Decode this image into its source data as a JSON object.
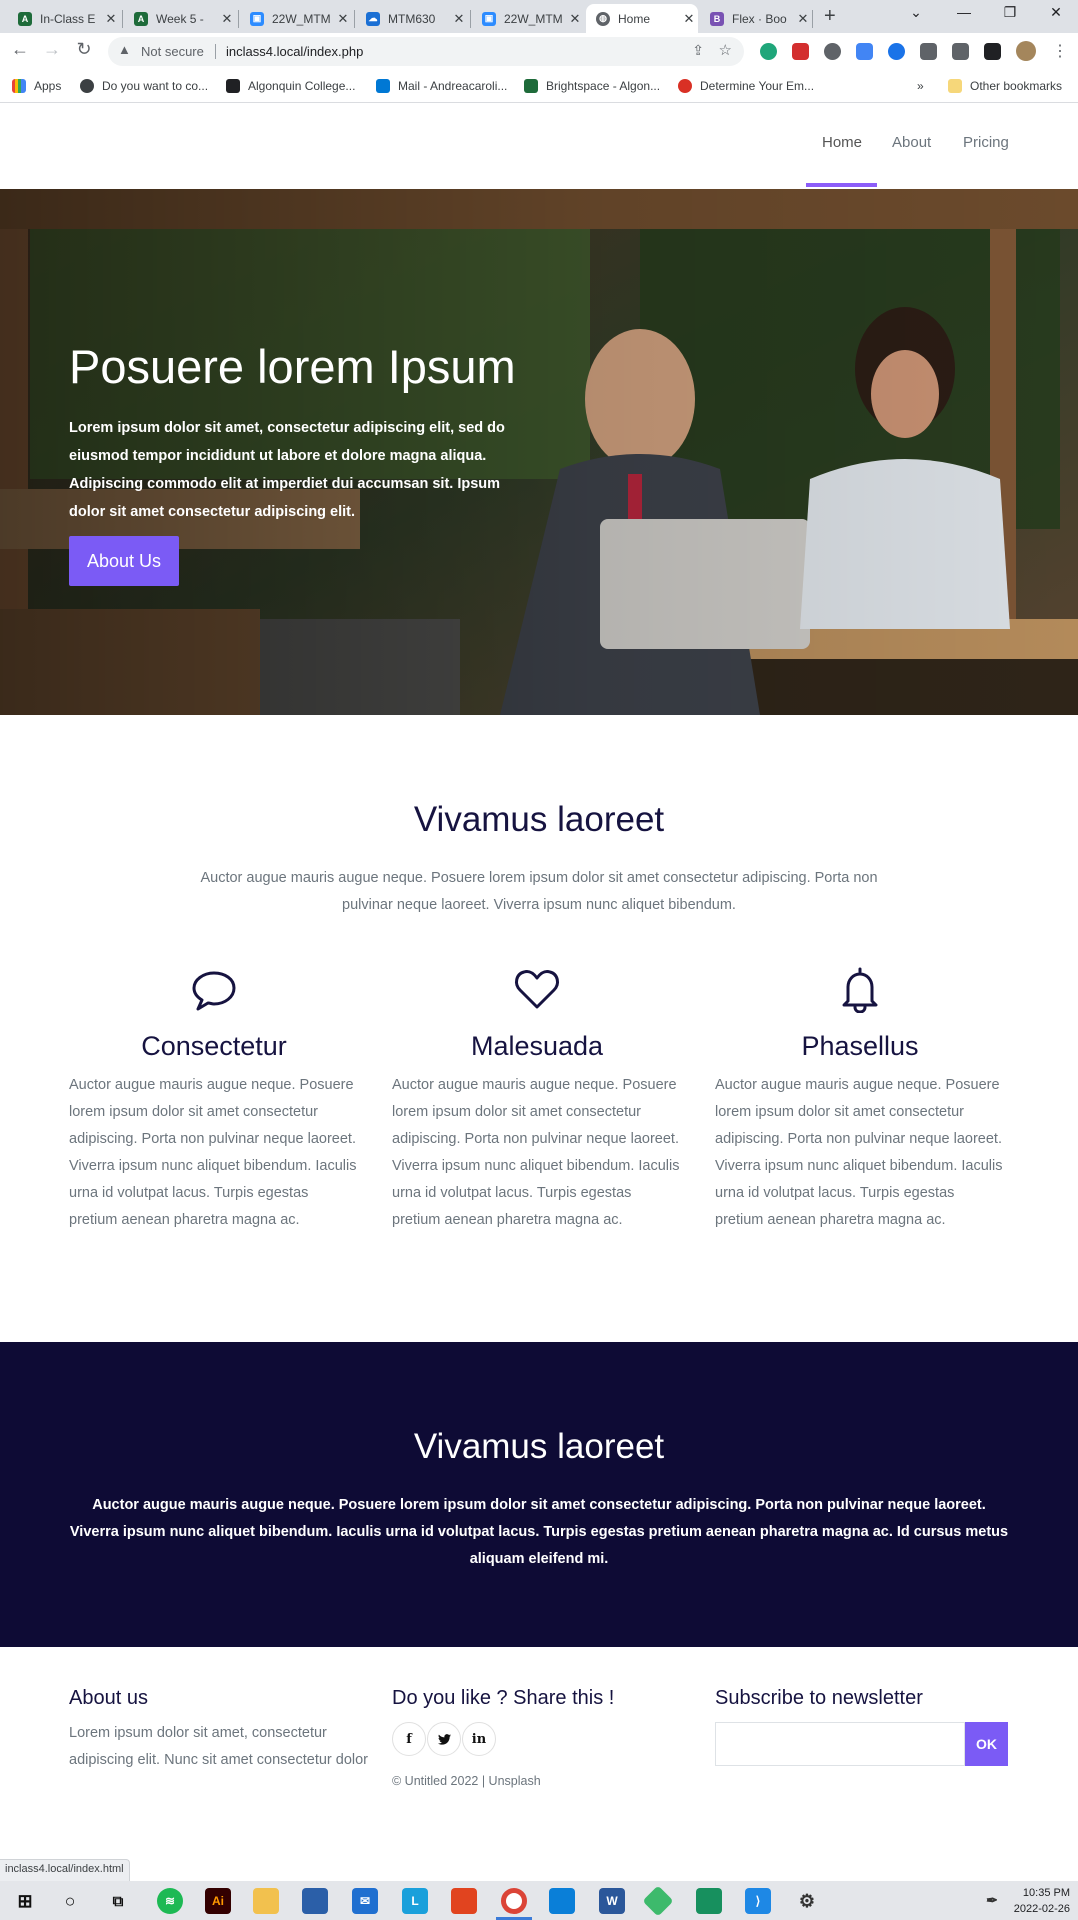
{
  "browser": {
    "tabs": [
      {
        "title": "In-Class E",
        "color": "#1e6b3a",
        "glyph": "A"
      },
      {
        "title": "Week 5 -",
        "color": "#1e6b3a",
        "glyph": "A"
      },
      {
        "title": "22W_MTM",
        "color": "#2d8cff",
        "glyph": "▣"
      },
      {
        "title": "MTM630",
        "color": "#1a6fd4",
        "glyph": "☁"
      },
      {
        "title": "22W_MTM",
        "color": "#2d8cff",
        "glyph": "▣"
      },
      {
        "title": "Home",
        "color": "#5f6368",
        "glyph": "◍"
      },
      {
        "title": "Flex · Boo",
        "color": "#7952b3",
        "glyph": "B"
      }
    ],
    "not_secure": "Not secure",
    "url": "inclass4.local/index.php",
    "bookmarks": [
      {
        "label": "Apps",
        "color": "#ea4335"
      },
      {
        "label": "Do you want to co...",
        "color": "#3c4043"
      },
      {
        "label": "Algonquin College...",
        "color": "#202124"
      },
      {
        "label": "Mail - Andreacaroli...",
        "color": "#0078d4"
      },
      {
        "label": "Brightspace - Algon...",
        "color": "#1e6b3a"
      },
      {
        "label": "Determine Your Em...",
        "color": "#d93025"
      }
    ],
    "other_bookmarks": "Other bookmarks",
    "status_url": "inclass4.local/index.html"
  },
  "site": {
    "nav": [
      {
        "label": "Home",
        "active": true
      },
      {
        "label": "About",
        "active": false
      },
      {
        "label": "Pricing",
        "active": false
      }
    ],
    "hero": {
      "title": "Posuere lorem Ipsum",
      "text": "Lorem ipsum dolor sit amet, consectetur adipiscing elit, sed do eiusmod tempor incididunt ut labore et dolore magna aliqua. Adipiscing commodo elit at imperdiet dui accumsan sit. Ipsum dolor sit amet consectetur adipiscing elit.",
      "button": "About Us"
    },
    "features": {
      "title": "Vivamus laoreet",
      "lead": "Auctor augue mauris augue neque. Posuere lorem ipsum dolor sit amet consectetur adipiscing. Porta non pulvinar neque laoreet. Viverra ipsum nunc aliquet bibendum.",
      "items": [
        {
          "icon": "speech-bubble-icon",
          "title": "Consectetur",
          "text": "Auctor augue mauris augue neque. Posuere lorem ipsum dolor sit amet consectetur adipiscing. Porta non pulvinar neque laoreet. Viverra ipsum nunc aliquet bibendum. Iaculis urna id volutpat lacus. Turpis egestas pretium aenean pharetra magna ac."
        },
        {
          "icon": "heart-icon",
          "title": "Malesuada",
          "text": "Auctor augue mauris augue neque. Posuere lorem ipsum dolor sit amet consectetur adipiscing. Porta non pulvinar neque laoreet. Viverra ipsum nunc aliquet bibendum. Iaculis urna id volutpat lacus. Turpis egestas pretium aenean pharetra magna ac."
        },
        {
          "icon": "bell-icon",
          "title": "Phasellus",
          "text": "Auctor augue mauris augue neque. Posuere lorem ipsum dolor sit amet consectetur adipiscing. Porta non pulvinar neque laoreet. Viverra ipsum nunc aliquet bibendum. Iaculis urna id volutpat lacus. Turpis egestas pretium aenean pharetra magna ac."
        }
      ]
    },
    "band": {
      "title": "Vivamus laoreet",
      "text": "Auctor augue mauris augue neque. Posuere lorem ipsum dolor sit amet consectetur adipiscing. Porta non pulvinar neque laoreet. Viverra ipsum nunc aliquet bibendum. Iaculis urna id volutpat lacus. Turpis egestas pretium aenean pharetra magna ac. Id cursus metus aliquam eleifend mi."
    },
    "footer": {
      "about_title": "About us",
      "about_text": "Lorem ipsum dolor sit amet, consectetur adipiscing elit. Nunc sit amet consectetur dolor",
      "share_title": "Do you like ? Share this !",
      "social": {
        "facebook": "f",
        "twitter": "🐦",
        "linkedin": "in"
      },
      "copyright": "© Untitled 2022 | Unsplash",
      "newsletter_title": "Subscribe to newsletter",
      "newsletter_placeholder": "",
      "ok": "OK"
    }
  },
  "taskbar": {
    "time": "10:35 PM",
    "date": "2022-02-26"
  },
  "colors": {
    "accent": "#7b5bf5",
    "navy": "#0e0b35",
    "heading": "#161340"
  }
}
